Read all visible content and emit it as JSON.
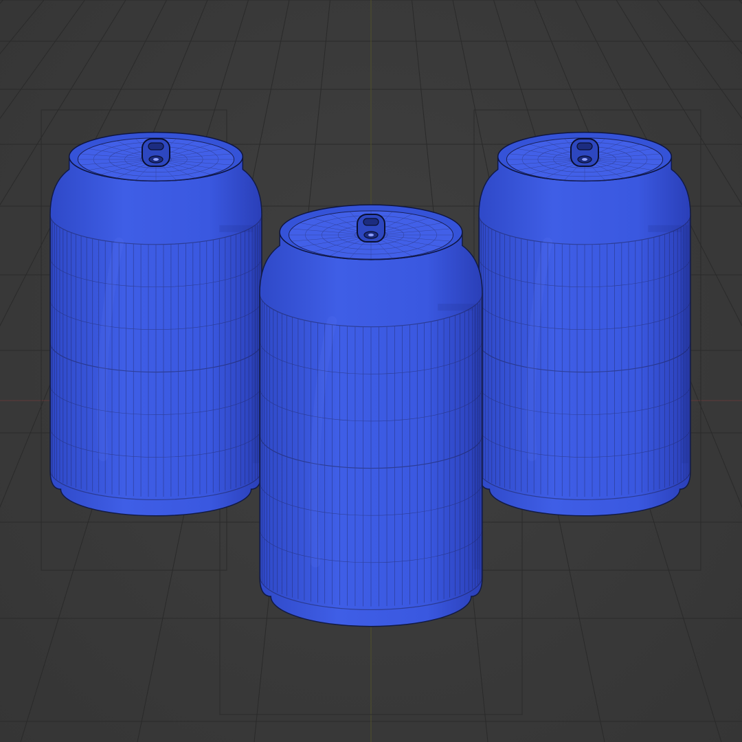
{
  "viewport": {
    "background": "#3a3a3a",
    "grid_color": "#2a2a2a",
    "axis_x_color": "#7a3a3a",
    "axis_y_color": "#6b6b2a",
    "wire_color": "#1a1a3a"
  },
  "scene": {
    "objects": [
      {
        "name": "soda-can-left",
        "color": "#3f5ee6",
        "has_pull_tab": true
      },
      {
        "name": "soda-can-center",
        "color": "#3f5ee6",
        "has_pull_tab": true
      },
      {
        "name": "soda-can-right",
        "color": "#3f5ee6",
        "has_pull_tab": true
      }
    ],
    "shading": "wireframe-overlay"
  }
}
